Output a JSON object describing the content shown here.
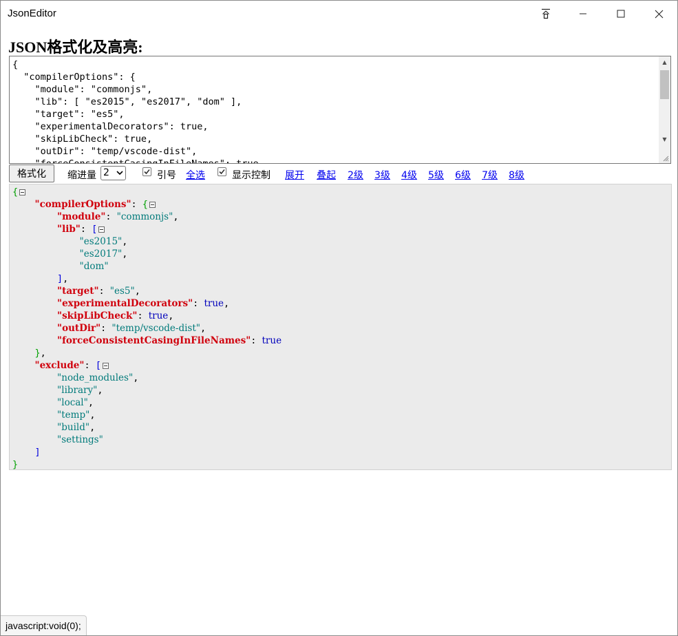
{
  "window": {
    "title": "JsonEditor"
  },
  "page": {
    "title": "JSON格式化及高亮:"
  },
  "source": {
    "lines": [
      "{",
      "  \"compilerOptions\": {",
      "    \"module\": \"commonjs\",",
      "    \"lib\": [ \"es2015\", \"es2017\", \"dom\" ],",
      "    \"target\": \"es5\",",
      "    \"experimentalDecorators\": true,",
      "    \"skipLibCheck\": true,",
      "    \"outDir\": \"temp/vscode-dist\",",
      "    \"forceConsistentCasingInFileNames\": true"
    ]
  },
  "toolbar": {
    "format_label": "格式化",
    "indent_label": "缩进量",
    "indent_value": "2",
    "quote_label": "引号",
    "select_all": "全选",
    "show_control_label": "显示控制",
    "expand": "展开",
    "collapse": "叠起",
    "levels": [
      "2级",
      "3级",
      "4级",
      "5级",
      "6级",
      "7级",
      "8级"
    ]
  },
  "tree": {
    "root_key": "compilerOptions",
    "compiler_options": [
      {
        "key": "module",
        "value": "commonjs",
        "type": "string"
      },
      {
        "key": "lib",
        "type": "array",
        "items": [
          "es2015",
          "es2017",
          "dom"
        ]
      },
      {
        "key": "target",
        "value": "es5",
        "type": "string"
      },
      {
        "key": "experimentalDecorators",
        "value": "true",
        "type": "bool"
      },
      {
        "key": "skipLibCheck",
        "value": "true",
        "type": "bool"
      },
      {
        "key": "outDir",
        "value": "temp/vscode-dist",
        "type": "string"
      },
      {
        "key": "forceConsistentCasingInFileNames",
        "value": "true",
        "type": "bool"
      }
    ],
    "exclude_key": "exclude",
    "exclude": [
      "node_modules",
      "library",
      "local",
      "temp",
      "build",
      "settings"
    ]
  },
  "status": {
    "text": "javascript:void(0);"
  },
  "colors": {
    "key": "#d0000d",
    "string": "#007a7a",
    "bool": "#0000bb",
    "object_brace": "#00a000",
    "array_bracket": "#0000dd",
    "tree_bg": "#ebebeb"
  }
}
